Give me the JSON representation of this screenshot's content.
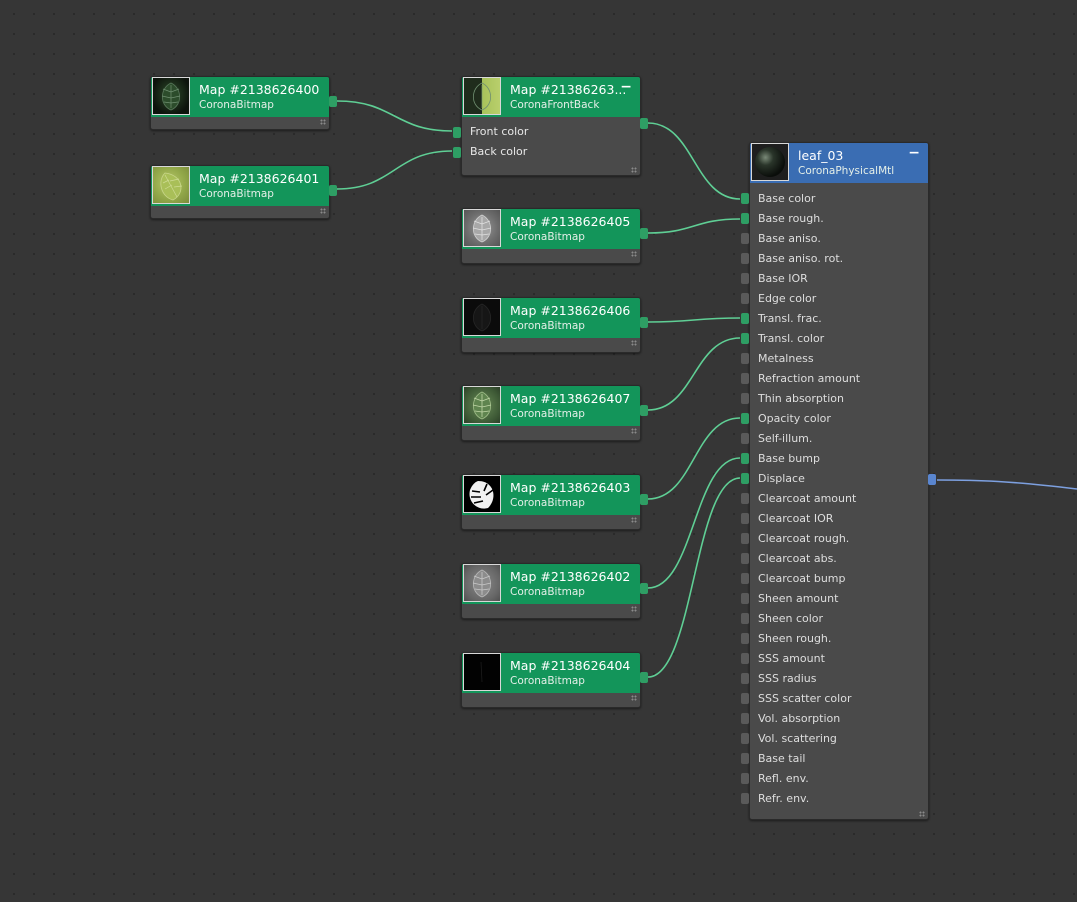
{
  "bitmap_nodes": [
    {
      "id": "n400",
      "title": "Map #2138626400",
      "subtitle": "CoronaBitmap"
    },
    {
      "id": "n401",
      "title": "Map #2138626401",
      "subtitle": "CoronaBitmap"
    },
    {
      "id": "n405",
      "title": "Map #2138626405",
      "subtitle": "CoronaBitmap"
    },
    {
      "id": "n406",
      "title": "Map #2138626406",
      "subtitle": "CoronaBitmap"
    },
    {
      "id": "n407",
      "title": "Map #2138626407",
      "subtitle": "CoronaBitmap"
    },
    {
      "id": "n403",
      "title": "Map #2138626403",
      "subtitle": "CoronaBitmap"
    },
    {
      "id": "n402",
      "title": "Map #2138626402",
      "subtitle": "CoronaBitmap"
    },
    {
      "id": "n404",
      "title": "Map #2138626404",
      "subtitle": "CoronaBitmap"
    }
  ],
  "frontback_node": {
    "title": "Map #21386263...",
    "subtitle": "CoronaFrontBack",
    "collapse": "−",
    "inputs": [
      "Front color",
      "Back color"
    ]
  },
  "material_node": {
    "title": "leaf_03",
    "subtitle": "CoronaPhysicalMtl",
    "collapse": "−",
    "inputs": [
      "Base color",
      "Base rough.",
      "Base aniso.",
      "Base aniso. rot.",
      "Base IOR",
      "Edge color",
      "Transl. frac.",
      "Transl. color",
      "Metalness",
      "Refraction amount",
      "Thin absorption",
      "Opacity color",
      "Self-illum.",
      "Base bump",
      "Displace",
      "Clearcoat amount",
      "Clearcoat IOR",
      "Clearcoat rough.",
      "Clearcoat abs.",
      "Clearcoat bump",
      "Sheen amount",
      "Sheen color",
      "Sheen rough.",
      "SSS amount",
      "SSS radius",
      "SSS scatter color",
      "Vol. absorption",
      "Vol. scattering",
      "Base tail",
      "Refl. env.",
      "Refr. env."
    ],
    "connected_inputs": [
      "Base color",
      "Base rough.",
      "Transl. frac.",
      "Transl. color",
      "Opacity color",
      "Base bump",
      "Displace"
    ]
  },
  "colors": {
    "canvas": "#363636",
    "node_body": "#4a4a4a",
    "map_header": "#13955a",
    "material_header": "#3a6db3",
    "wire": "#5fcf95",
    "output_wire": "#7da0e0",
    "port_connected": "#2e9e64",
    "port_empty": "#5a5a5a"
  },
  "thumbnails": {
    "n400": "dark-leaf-color",
    "n401": "light-green-leaf",
    "n405": "gray-leaf-roughness",
    "n406": "black-leaf-translucency",
    "n407": "green-leaf-transl-color",
    "n403": "white-leaf-opacity-mask",
    "n402": "gray-leaf-bump",
    "n404": "black-leaf-displace",
    "frontback": "split-dark-green-and-lime",
    "material": "dark-sphere-preview"
  }
}
